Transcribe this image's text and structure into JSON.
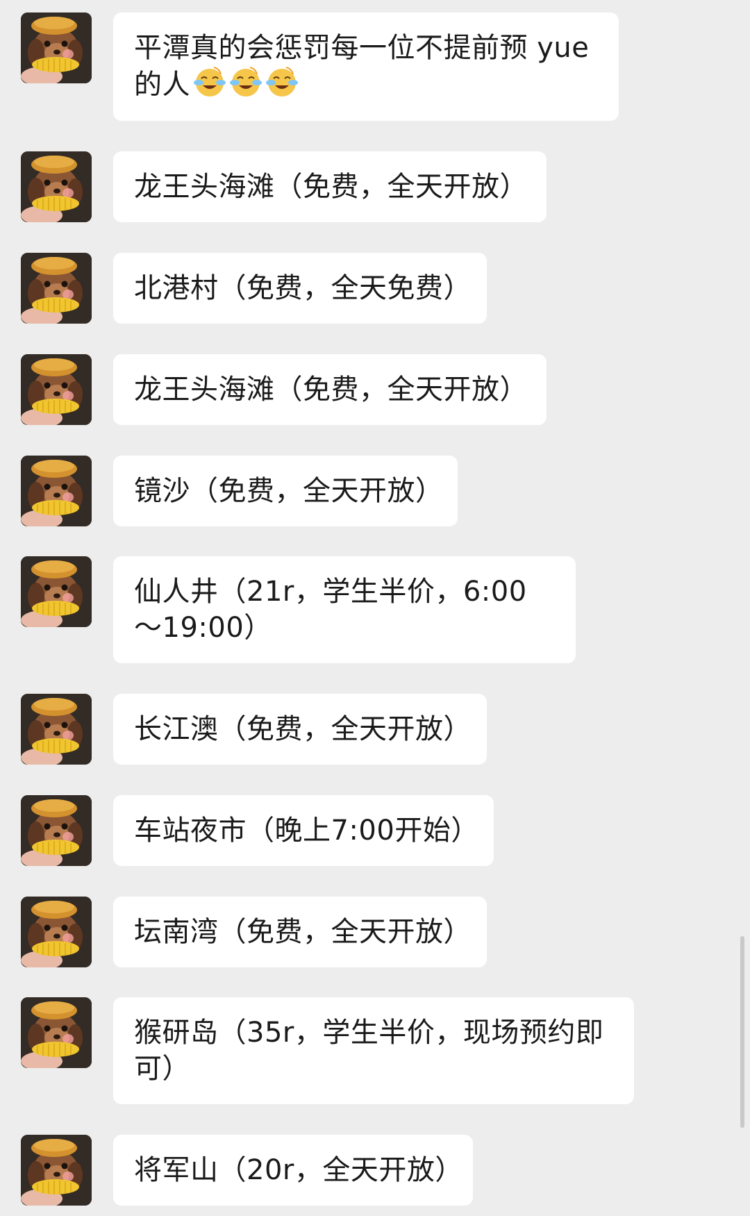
{
  "colors": {
    "background": "#ededed",
    "bubble": "#ffffff",
    "text": "#1a1a1a",
    "scrollbar": "#c9c9c9"
  },
  "messages": [
    {
      "text": "平潭真的会惩罚每一位不提前预 yue 的人",
      "emoji": [
        "laughing-crying-emoji",
        "laughing-crying-emoji",
        "laughing-crying-emoji"
      ],
      "avatar": "dog-with-bun-avatar"
    },
    {
      "text": "龙王头海滩（免费，全天开放）",
      "avatar": "dog-with-bun-avatar"
    },
    {
      "text": "北港村（免费，全天免费）",
      "avatar": "dog-with-bun-avatar"
    },
    {
      "text": "龙王头海滩（免费，全天开放）",
      "avatar": "dog-with-bun-avatar"
    },
    {
      "text": "镜沙（免费，全天开放）",
      "avatar": "dog-with-bun-avatar"
    },
    {
      "text": "仙人井（21r，学生半价，6:00～19:00）",
      "avatar": "dog-with-bun-avatar"
    },
    {
      "text": "长江澳（免费，全天开放）",
      "avatar": "dog-with-bun-avatar"
    },
    {
      "text": "车站夜市（晚上7:00开始）",
      "avatar": "dog-with-bun-avatar"
    },
    {
      "text": "坛南湾（免费，全天开放）",
      "avatar": "dog-with-bun-avatar"
    },
    {
      "text": "猴研岛（35r，学生半价，现场预约即可）",
      "avatar": "dog-with-bun-avatar"
    },
    {
      "text": "将军山（20r，全天开放）",
      "avatar": "dog-with-bun-avatar"
    }
  ]
}
